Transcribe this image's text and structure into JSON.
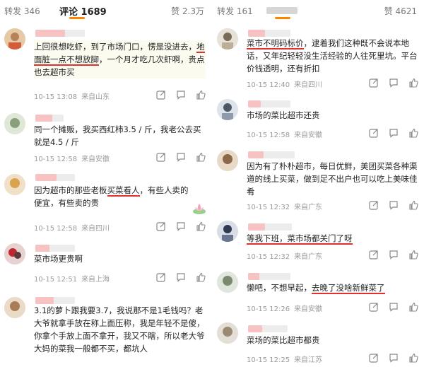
{
  "left": {
    "tabs": [
      {
        "label": "转发",
        "count": "346"
      },
      {
        "label": "评论",
        "count": "1689"
      }
    ],
    "likes_total": "赞 2.3万",
    "comments": [
      {
        "text_a": "上回很想吃虾，到了市场门口，愣是没进去，",
        "highlight": "地面脏一点不想放脚",
        "text_b": "，一个月才吃几次虾啊，贵点也去超市买",
        "time": "10-15 13:08",
        "location": "来自山东"
      },
      {
        "text_a": "同一个摊贩，我买西红柿3.5 / 斤，我老公去买就是4.5 / 斤",
        "highlight": "",
        "text_b": "",
        "time": "10-15 12:58",
        "location": "来自安徽"
      },
      {
        "text_a": "因为超市的那些老板",
        "highlight": "买菜看人",
        "text_b": "，有些人卖的便宜，有些卖的贵",
        "time": "10-15 12:58",
        "location": "来自四川"
      },
      {
        "text_a": "菜市场更贵啊",
        "highlight": "",
        "text_b": "",
        "time": "10-15 12:51",
        "location": "来自上海"
      },
      {
        "text_a": "3.1的萝卜跟我要3.7，我说那不是1毛钱吗？老大爷就拿手放在称上面压称，我是年轻不是傻，你拿个手放上面不拿开，我又不瞎，所以老大爷大妈的菜我一般都不买，都坑人",
        "highlight": "",
        "text_b": "",
        "time": "",
        "location": ""
      }
    ]
  },
  "right": {
    "tabs": [
      {
        "label": "转发",
        "count": "161"
      }
    ],
    "likes_total": "赞 4621",
    "comments": [
      {
        "text_a": "",
        "highlight": "菜市不明码标价",
        "text_b": "，逮着我们这种既不会说本地话，又年纪轻轻没生活经验的人往死里坑。平台价钱透明，还有折扣",
        "time": "10-15 12:40",
        "location": "来自四川"
      },
      {
        "text_a": "市场的菜比超市还贵",
        "highlight": "",
        "text_b": "",
        "time": "10-15 12:58",
        "location": "来自安徽"
      },
      {
        "text_a": "因为有了朴朴超市，每日优鲜，美团买菜各种渠道的线上买菜，做到足不出户也可以吃上美味佳肴",
        "highlight": "",
        "text_b": "",
        "time": "10-15 12:32",
        "location": "来自广东"
      },
      {
        "text_a": "",
        "highlight": "等我下班，菜市场都关门了呀",
        "text_b": "",
        "time": "10-15 12:32",
        "location": "来自广东"
      },
      {
        "text_a": "懒吧，不想早起，",
        "highlight": "去晚了没啥新鲜菜了",
        "text_b": "",
        "time": "10-15 12:26",
        "location": "来自安徽"
      },
      {
        "text_a": "菜场的菜比超市都贵",
        "highlight": "",
        "text_b": "",
        "time": "10-15 12:25",
        "location": "来自江苏"
      }
    ]
  },
  "colors": {
    "accent": "#ff8200",
    "highlight_underline": "#e0312f",
    "meta_gray": "#9a9a9a"
  },
  "icons": [
    "share-icon",
    "comment-icon",
    "like-icon"
  ]
}
